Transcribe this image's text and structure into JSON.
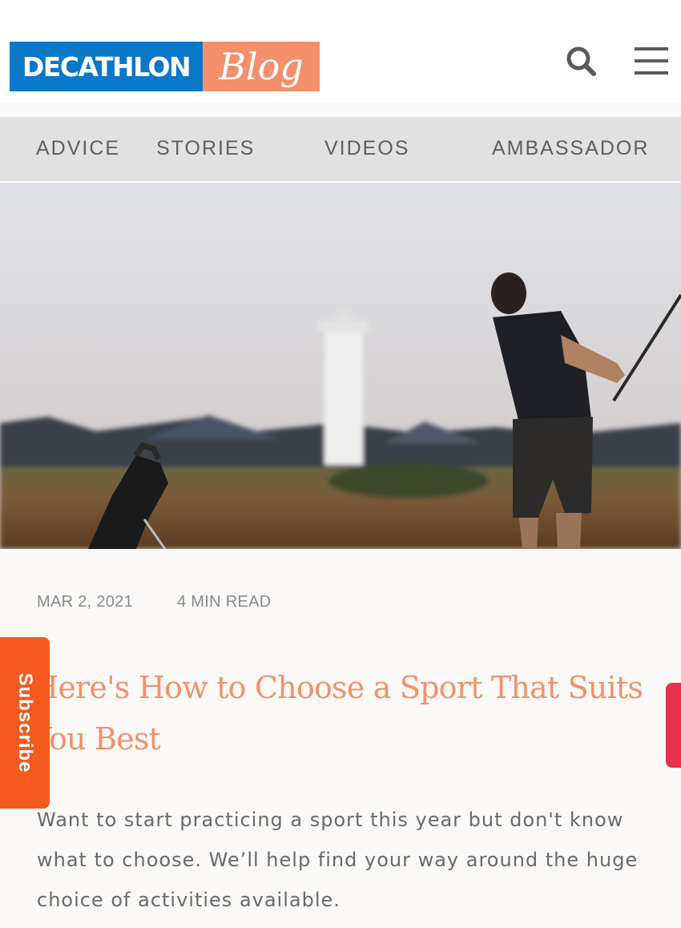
{
  "header": {
    "logo_brand": "DECATHLON",
    "logo_blog": "Blog",
    "icons": {
      "search": "search-icon",
      "menu": "hamburger-menu-icon"
    }
  },
  "nav": {
    "items": [
      {
        "label": "ADVICE"
      },
      {
        "label": "STORIES"
      },
      {
        "label": "VIDEOS"
      },
      {
        "label": "AMBASSADOR"
      }
    ]
  },
  "article": {
    "date": "MAR 2, 2021",
    "read_time": "4  MIN READ",
    "title": "Here's How to Choose a Sport That Suits You Best",
    "excerpt": "Want to start practicing a sport this year but don't know what to choose. We’ll help find your way around the huge choice of activities available."
  },
  "subscribe": {
    "label": "Subscribe"
  },
  "colors": {
    "brand_blue": "#0a78c8",
    "blog_orange": "#f4906c",
    "subscribe_orange": "#f45a1e",
    "side_tab_pink": "#e8304f",
    "nav_background": "#e1e1e1",
    "title_color": "#f4906c"
  }
}
